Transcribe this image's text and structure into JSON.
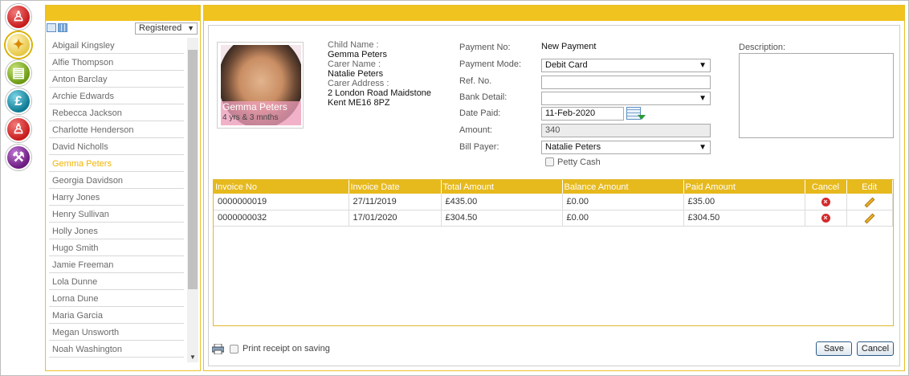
{
  "rail": {
    "icons": [
      "family-icon",
      "connections-icon",
      "document-icon",
      "pound-icon",
      "child-icon",
      "wrench-icon"
    ]
  },
  "list": {
    "filter_value": "Registered",
    "items": [
      "Abigail Kingsley",
      "Alfie Thompson",
      "Anton Barclay",
      "Archie Edwards",
      "Rebecca Jackson",
      "Charlotte Henderson",
      "David Nicholls",
      "Gemma Peters",
      "Georgia Davidson",
      "Harry Jones",
      "Henry Sullivan",
      "Holly Jones",
      "Hugo Smith",
      "Jamie Freeman",
      "Lola Dunne",
      "Lorna Dune",
      "Maria Garcia",
      "Megan Unsworth",
      "Noah Washington"
    ],
    "active_index": 7
  },
  "child": {
    "photo_name": "Gemma Peters",
    "photo_age": "4 yrs & 3 mnths",
    "child_name_label": "Child Name :",
    "child_name": "Gemma Peters",
    "carer_name_label": "Carer Name :",
    "carer_name": "Natalie Peters",
    "carer_address_label": "Carer Address :",
    "carer_address_1": "2 London Road Maidstone",
    "carer_address_2": "Kent ME16 8PZ"
  },
  "form": {
    "payment_no_label": "Payment No:",
    "payment_no": "New Payment",
    "payment_mode_label": "Payment Mode:",
    "payment_mode": "Debit Card",
    "ref_no_label": "Ref. No.",
    "ref_no": "",
    "bank_detail_label": "Bank Detail:",
    "bank_detail": "",
    "date_paid_label": "Date Paid:",
    "date_paid": "11-Feb-2020",
    "amount_label": "Amount:",
    "amount": "340",
    "bill_payer_label": "Bill Payer:",
    "bill_payer": "Natalie Peters",
    "petty_cash_label": "Petty Cash",
    "description_label": "Description:"
  },
  "invoices": {
    "headers": [
      "Invoice No",
      "Invoice Date",
      "Total Amount",
      "Balance Amount",
      "Paid Amount",
      "Cancel",
      "Edit"
    ],
    "rows": [
      {
        "invoice_no": "0000000019",
        "date": "27/11/2019",
        "total": "£435.00",
        "balance": "£0.00",
        "paid": "£35.00"
      },
      {
        "invoice_no": "0000000032",
        "date": "17/01/2020",
        "total": "£304.50",
        "balance": "£0.00",
        "paid": "£304.50"
      }
    ]
  },
  "footer": {
    "print_label": "Print receipt on saving",
    "save_label": "Save",
    "cancel_label": "Cancel"
  },
  "colors": {
    "accent": "#f0c31e",
    "active_item": "#f0b400",
    "table_header": "#e6b91d"
  }
}
